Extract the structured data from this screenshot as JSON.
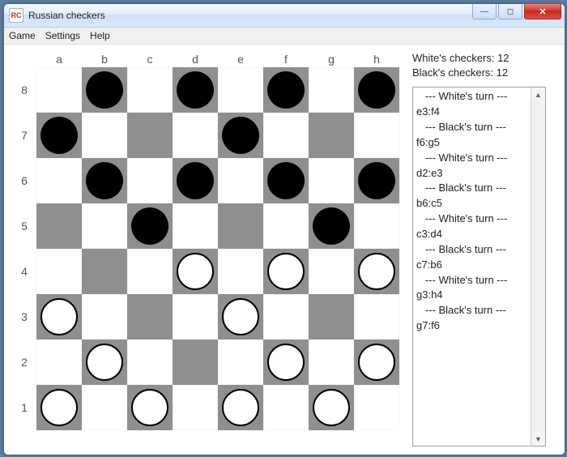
{
  "window": {
    "title": "Russian checkers",
    "icon_text": "RC"
  },
  "menubar": {
    "items": [
      "Game",
      "Settings",
      "Help"
    ]
  },
  "board": {
    "files": [
      "a",
      "b",
      "c",
      "d",
      "e",
      "f",
      "g",
      "h"
    ],
    "ranks": [
      "8",
      "7",
      "6",
      "5",
      "4",
      "3",
      "2",
      "1"
    ],
    "pieces": [
      {
        "file": "b",
        "rank": "8",
        "color": "black"
      },
      {
        "file": "d",
        "rank": "8",
        "color": "black"
      },
      {
        "file": "f",
        "rank": "8",
        "color": "black"
      },
      {
        "file": "h",
        "rank": "8",
        "color": "black"
      },
      {
        "file": "a",
        "rank": "7",
        "color": "black"
      },
      {
        "file": "e",
        "rank": "7",
        "color": "black"
      },
      {
        "file": "b",
        "rank": "6",
        "color": "black"
      },
      {
        "file": "d",
        "rank": "6",
        "color": "black"
      },
      {
        "file": "f",
        "rank": "6",
        "color": "black"
      },
      {
        "file": "h",
        "rank": "6",
        "color": "black"
      },
      {
        "file": "c",
        "rank": "5",
        "color": "black"
      },
      {
        "file": "g",
        "rank": "5",
        "color": "black"
      },
      {
        "file": "d",
        "rank": "4",
        "color": "white"
      },
      {
        "file": "f",
        "rank": "4",
        "color": "white"
      },
      {
        "file": "h",
        "rank": "4",
        "color": "white"
      },
      {
        "file": "a",
        "rank": "3",
        "color": "white"
      },
      {
        "file": "e",
        "rank": "3",
        "color": "white"
      },
      {
        "file": "b",
        "rank": "2",
        "color": "white"
      },
      {
        "file": "f",
        "rank": "2",
        "color": "white"
      },
      {
        "file": "h",
        "rank": "2",
        "color": "white"
      },
      {
        "file": "a",
        "rank": "1",
        "color": "white"
      },
      {
        "file": "c",
        "rank": "1",
        "color": "white"
      },
      {
        "file": "e",
        "rank": "1",
        "color": "white"
      },
      {
        "file": "g",
        "rank": "1",
        "color": "white"
      }
    ]
  },
  "side": {
    "white_label": "White's checkers: 12",
    "black_label": "Black's checkers: 12",
    "log": [
      "   --- White's turn ---",
      "e3:f4",
      "   --- Black's turn ---",
      "f6:g5",
      "   --- White's turn ---",
      "d2:e3",
      "   --- Black's turn ---",
      "b6:c5",
      "   --- White's turn ---",
      "c3:d4",
      "   --- Black's turn ---",
      "c7:b6",
      "   --- White's turn ---",
      "g3:h4",
      "   --- Black's turn ---",
      "g7:f6"
    ]
  },
  "win_buttons": {
    "min_glyph": "—",
    "max_glyph": "◻",
    "close_glyph": "✕"
  }
}
